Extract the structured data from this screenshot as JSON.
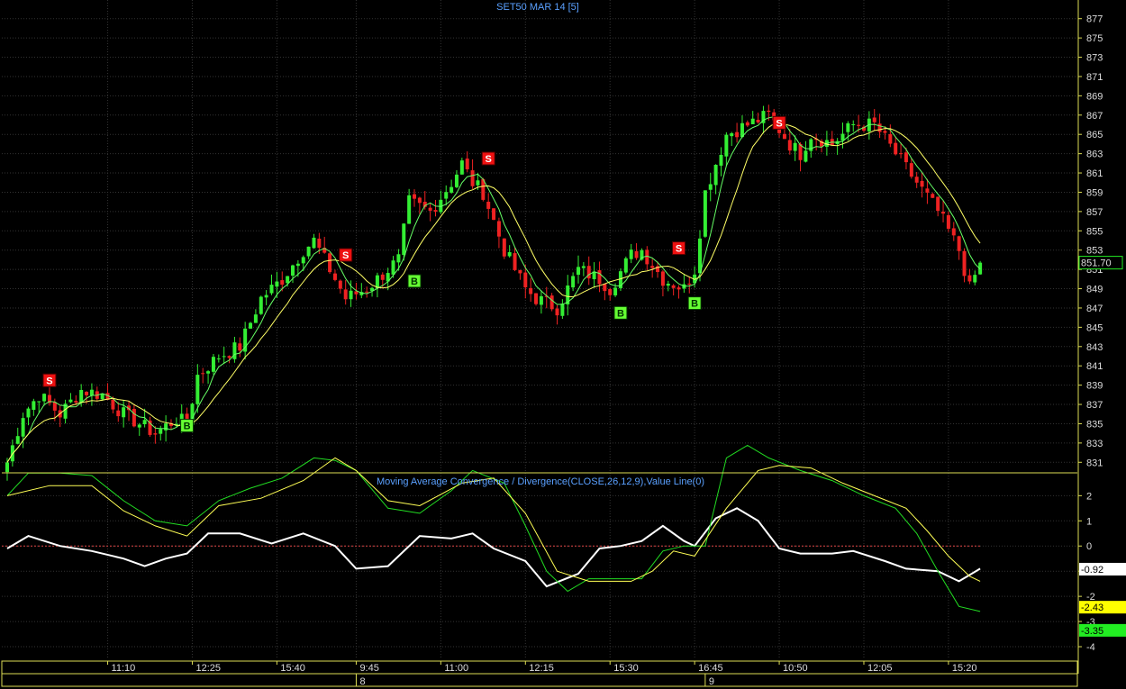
{
  "chart_data": [
    {
      "type": "candlestick",
      "title": "SET50 MAR 14   [5]",
      "ylim": [
        830,
        878
      ],
      "y_ticks": [
        831,
        833,
        835,
        837,
        839,
        841,
        843,
        845,
        847,
        849,
        851,
        853,
        855,
        857,
        859,
        861,
        863,
        865,
        867,
        869,
        871,
        873,
        875,
        877
      ],
      "last_price_label": "851.70",
      "last_price": 851.7,
      "colors": {
        "up": "#33ee33",
        "down": "#ee2222",
        "ma_fast": "#66ff66",
        "ma_slow": "#ffff66",
        "grid": "#333333",
        "axis": "#ffff66"
      },
      "ohlc_anchors": [
        [
          0,
          831
        ],
        [
          3,
          836
        ],
        [
          6,
          838
        ],
        [
          10,
          836
        ],
        [
          14,
          838.5
        ],
        [
          18,
          838
        ],
        [
          22,
          836
        ],
        [
          28,
          834
        ],
        [
          32,
          835.5
        ],
        [
          34,
          835
        ],
        [
          36,
          840
        ],
        [
          40,
          842
        ],
        [
          44,
          843
        ],
        [
          48,
          848
        ],
        [
          52,
          850
        ],
        [
          56,
          853
        ],
        [
          58,
          854
        ],
        [
          60,
          852
        ],
        [
          64,
          848
        ],
        [
          68,
          849
        ],
        [
          70,
          850
        ],
        [
          74,
          852
        ],
        [
          76,
          858
        ],
        [
          80,
          857
        ],
        [
          84,
          860
        ],
        [
          86,
          862
        ],
        [
          88,
          860
        ],
        [
          90,
          859
        ],
        [
          94,
          853
        ],
        [
          98,
          849
        ],
        [
          100,
          848
        ],
        [
          104,
          847
        ],
        [
          108,
          851
        ],
        [
          112,
          850
        ],
        [
          114,
          849
        ],
        [
          118,
          852.5
        ],
        [
          120,
          853
        ],
        [
          124,
          850
        ],
        [
          128,
          849
        ],
        [
          130,
          851
        ],
        [
          132,
          859
        ],
        [
          136,
          865
        ],
        [
          140,
          866
        ],
        [
          144,
          867
        ],
        [
          148,
          864
        ],
        [
          150,
          863
        ],
        [
          152,
          865
        ],
        [
          156,
          864
        ],
        [
          160,
          866
        ],
        [
          164,
          866
        ],
        [
          168,
          863
        ],
        [
          172,
          860
        ],
        [
          176,
          857
        ],
        [
          180,
          853
        ],
        [
          182,
          849
        ],
        [
          184,
          851.7
        ]
      ],
      "candle_count": 185,
      "signals": [
        {
          "label": "S",
          "index": 8,
          "price": 839.5
        },
        {
          "label": "B",
          "index": 34,
          "price": 834.8
        },
        {
          "label": "S",
          "index": 64,
          "price": 852.5
        },
        {
          "label": "B",
          "index": 77,
          "price": 849.8
        },
        {
          "label": "S",
          "index": 91,
          "price": 862.5
        },
        {
          "label": "B",
          "index": 116,
          "price": 846.5
        },
        {
          "label": "S",
          "index": 127,
          "price": 853.2
        },
        {
          "label": "B",
          "index": 130,
          "price": 847.5
        },
        {
          "label": "S",
          "index": 146,
          "price": 866.2
        }
      ]
    },
    {
      "type": "line",
      "title": "Moving Average Convergence / Divergence(CLOSE,26,12,9),Value Line(0)",
      "ylim": [
        -4.5,
        2.8
      ],
      "y_ticks": [
        2,
        1,
        0,
        -1,
        -2,
        -3,
        -4
      ],
      "value_labels": [
        {
          "text": "-0.92",
          "value": -0.92,
          "color": "#ffffff",
          "text_color": "#000000"
        },
        {
          "text": "-2.43",
          "value": -2.43,
          "color": "#ffff00",
          "text_color": "#000000"
        },
        {
          "text": "-3.35",
          "value": -3.35,
          "color": "#22ee22",
          "text_color": "#000000"
        }
      ],
      "zero_line": 0,
      "series": [
        {
          "key": "white",
          "color": "#ffffff",
          "points": [
            [
              0,
              -0.1
            ],
            [
              4,
              0.4
            ],
            [
              10,
              0.0
            ],
            [
              16,
              -0.2
            ],
            [
              22,
              -0.5
            ],
            [
              26,
              -0.8
            ],
            [
              30,
              -0.5
            ],
            [
              34,
              -0.3
            ],
            [
              38,
              0.5
            ],
            [
              44,
              0.5
            ],
            [
              50,
              0.1
            ],
            [
              56,
              0.5
            ],
            [
              62,
              0.0
            ],
            [
              66,
              -0.9
            ],
            [
              72,
              -0.8
            ],
            [
              78,
              0.4
            ],
            [
              84,
              0.3
            ],
            [
              88,
              0.5
            ],
            [
              92,
              -0.1
            ],
            [
              98,
              -0.6
            ],
            [
              102,
              -1.6
            ],
            [
              108,
              -1.1
            ],
            [
              112,
              -0.1
            ],
            [
              116,
              0.0
            ],
            [
              120,
              0.2
            ],
            [
              124,
              0.8
            ],
            [
              128,
              0.2
            ],
            [
              130,
              0.0
            ],
            [
              134,
              1.1
            ],
            [
              138,
              1.5
            ],
            [
              142,
              1.0
            ],
            [
              146,
              -0.1
            ],
            [
              150,
              -0.3
            ],
            [
              156,
              -0.3
            ],
            [
              160,
              -0.2
            ],
            [
              166,
              -0.6
            ],
            [
              170,
              -0.9
            ],
            [
              176,
              -1.0
            ],
            [
              180,
              -1.4
            ],
            [
              184,
              -0.9
            ]
          ]
        },
        {
          "key": "green",
          "color": "#22dd22",
          "points": [
            [
              0,
              2.0
            ],
            [
              4,
              2.9
            ],
            [
              10,
              2.9
            ],
            [
              16,
              2.8
            ],
            [
              22,
              1.8
            ],
            [
              28,
              1.0
            ],
            [
              34,
              0.8
            ],
            [
              40,
              1.8
            ],
            [
              46,
              2.3
            ],
            [
              52,
              2.7
            ],
            [
              58,
              3.5
            ],
            [
              62,
              3.4
            ],
            [
              66,
              3.0
            ],
            [
              72,
              1.5
            ],
            [
              78,
              1.3
            ],
            [
              84,
              2.2
            ],
            [
              88,
              3.0
            ],
            [
              94,
              2.5
            ],
            [
              98,
              0.8
            ],
            [
              102,
              -1.0
            ],
            [
              106,
              -1.8
            ],
            [
              110,
              -1.3
            ],
            [
              116,
              -1.3
            ],
            [
              120,
              -1.3
            ],
            [
              124,
              -0.2
            ],
            [
              128,
              0.0
            ],
            [
              132,
              0.0
            ],
            [
              136,
              3.5
            ],
            [
              140,
              4.0
            ],
            [
              144,
              3.5
            ],
            [
              150,
              3.0
            ],
            [
              156,
              2.6
            ],
            [
              162,
              2.0
            ],
            [
              168,
              1.5
            ],
            [
              172,
              0.5
            ],
            [
              176,
              -1.0
            ],
            [
              180,
              -2.4
            ],
            [
              184,
              -2.6
            ]
          ]
        },
        {
          "key": "yellow",
          "color": "#ffff55",
          "points": [
            [
              0,
              2.0
            ],
            [
              8,
              2.4
            ],
            [
              16,
              2.4
            ],
            [
              22,
              1.4
            ],
            [
              28,
              0.8
            ],
            [
              34,
              0.4
            ],
            [
              40,
              1.6
            ],
            [
              48,
              1.9
            ],
            [
              56,
              2.6
            ],
            [
              62,
              3.5
            ],
            [
              66,
              3.0
            ],
            [
              72,
              1.8
            ],
            [
              78,
              1.6
            ],
            [
              86,
              2.5
            ],
            [
              92,
              2.7
            ],
            [
              98,
              1.3
            ],
            [
              104,
              -1.0
            ],
            [
              110,
              -1.4
            ],
            [
              118,
              -1.4
            ],
            [
              122,
              -1.0
            ],
            [
              126,
              -0.2
            ],
            [
              130,
              -0.4
            ],
            [
              136,
              1.5
            ],
            [
              142,
              3.0
            ],
            [
              146,
              3.2
            ],
            [
              152,
              3.1
            ],
            [
              158,
              2.5
            ],
            [
              164,
              2.0
            ],
            [
              170,
              1.5
            ],
            [
              174,
              0.6
            ],
            [
              178,
              -0.4
            ],
            [
              182,
              -1.2
            ],
            [
              184,
              -1.4
            ]
          ]
        }
      ]
    }
  ],
  "time_axis": {
    "labels": [
      {
        "text": "11:10",
        "index": 19
      },
      {
        "text": "12:25",
        "index": 35
      },
      {
        "text": "15:40",
        "index": 51
      },
      {
        "text": "9:45",
        "index": 66
      },
      {
        "text": "11:00",
        "index": 82
      },
      {
        "text": "12:15",
        "index": 98
      },
      {
        "text": "15:30",
        "index": 114
      },
      {
        "text": "16:45",
        "index": 130
      },
      {
        "text": "10:50",
        "index": 146
      },
      {
        "text": "12:05",
        "index": 162
      },
      {
        "text": "15:20",
        "index": 178
      }
    ],
    "day_labels": [
      {
        "text": "8",
        "index": 66
      },
      {
        "text": "9",
        "index": 132
      }
    ]
  }
}
